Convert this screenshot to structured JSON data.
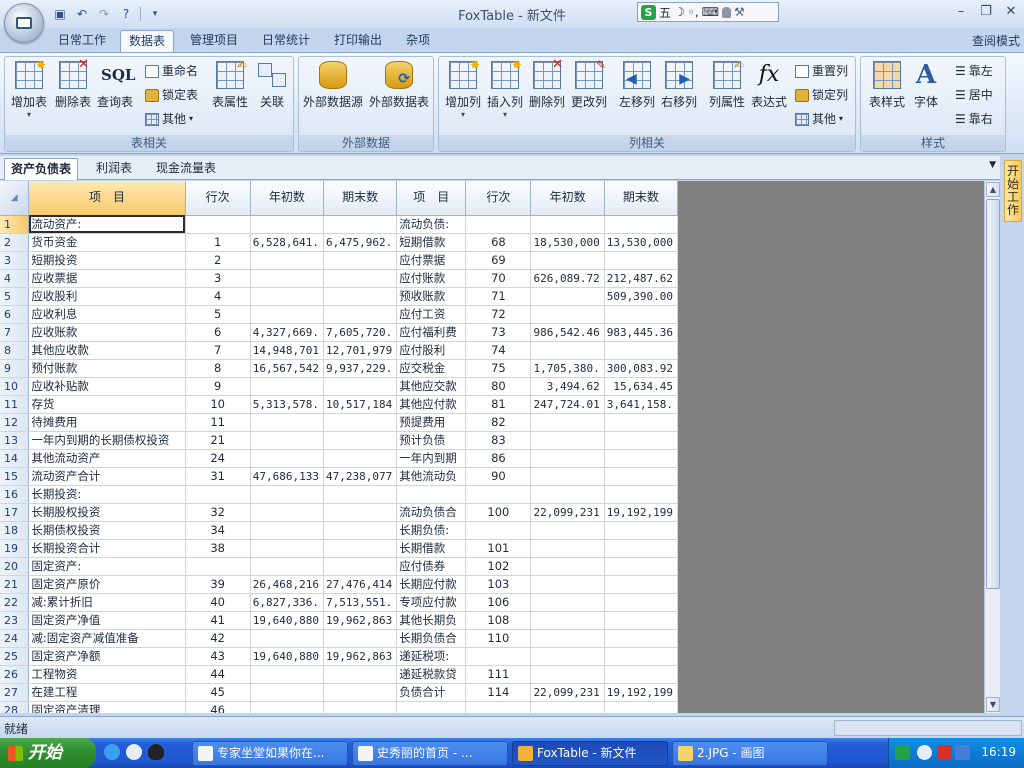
{
  "titlebar": {
    "title": "FoxTable - 新文件",
    "ime": {
      "s_logo": "S",
      "mode": "五",
      "moon": "☽",
      "punct": "◦,",
      "keyboard": "⌨",
      "user": "👤",
      "tool": "🔧"
    },
    "minimize": "–",
    "restore": "❐",
    "close": "✕"
  },
  "ribbon_tabs": [
    "日常工作",
    "数据表",
    "管理项目",
    "日常统计",
    "打印输出",
    "杂项"
  ],
  "active_tab": "数据表",
  "view_mode": "查阅模式",
  "groups": {
    "table": {
      "label": "表相关",
      "add_table": "增加表",
      "delete_table": "删除表",
      "query_table": "查询表",
      "rename": "重命名",
      "lock_table": "锁定表",
      "other": "其他",
      "table_props": "表属性",
      "relation": "关联"
    },
    "external": {
      "label": "外部数据",
      "source": "外部数据源",
      "table": "外部数据表"
    },
    "columns": {
      "label": "列相关",
      "add_col": "增加列",
      "insert_col": "插入列",
      "delete_col": "删除列",
      "rename_col": "更改列",
      "move_left": "左移列",
      "move_right": "右移列",
      "col_props": "列属性",
      "expression": "表达式",
      "reset_col": "重置列",
      "lock_col": "锁定列",
      "other": "其他"
    },
    "style": {
      "label": "样式",
      "table_style": "表样式",
      "font": "字体",
      "align_left": "靠左",
      "align_center": "居中",
      "align_right": "靠右"
    }
  },
  "sheet_tabs": [
    "资产负债表",
    "利润表",
    "现金流量表"
  ],
  "active_sheet": "资产负债表",
  "side_panel_label": "开始工作",
  "grid": {
    "headers": [
      "项　目",
      "行次",
      "年初数",
      "期末数",
      "项　目",
      "行次",
      "年初数",
      "期末数"
    ],
    "rows": [
      [
        "1",
        "流动资产:",
        "",
        "",
        "",
        "流动负债:",
        "",
        "",
        ""
      ],
      [
        "2",
        "货币资金",
        "1",
        "6,528,641.",
        "6,475,962.",
        "短期借款",
        "68",
        "18,530,000",
        "13,530,000"
      ],
      [
        "3",
        "短期投资",
        "2",
        "",
        "",
        "应付票据",
        "69",
        "",
        ""
      ],
      [
        "4",
        "应收票据",
        "3",
        "",
        "",
        "应付账款",
        "70",
        "626,089.72",
        "212,487.62"
      ],
      [
        "5",
        "应收股利",
        "4",
        "",
        "",
        "预收账款",
        "71",
        "",
        "509,390.00"
      ],
      [
        "6",
        "应收利息",
        "5",
        "",
        "",
        "应付工资",
        "72",
        "",
        ""
      ],
      [
        "7",
        "应收账款",
        "6",
        "4,327,669.",
        "7,605,720.",
        "应付福利费",
        "73",
        "986,542.46",
        "983,445.36"
      ],
      [
        "8",
        "其他应收款",
        "7",
        "14,948,701",
        "12,701,979",
        "应付股利",
        "74",
        "",
        ""
      ],
      [
        "9",
        "预付账款",
        "8",
        "16,567,542",
        "9,937,229.",
        "应交税金",
        "75",
        "1,705,380.",
        "300,083.92"
      ],
      [
        "10",
        "应收补贴款",
        "9",
        "",
        "",
        "其他应交款",
        "80",
        "3,494.62",
        "15,634.45"
      ],
      [
        "11",
        "存货",
        "10",
        "5,313,578.",
        "10,517,184",
        "其他应付款",
        "81",
        "247,724.01",
        "3,641,158."
      ],
      [
        "12",
        "待摊费用",
        "11",
        "",
        "",
        "预提费用",
        "82",
        "",
        ""
      ],
      [
        "13",
        "一年内到期的长期债权投资",
        "21",
        "",
        "",
        "预计负债",
        "83",
        "",
        ""
      ],
      [
        "14",
        "其他流动资产",
        "24",
        "",
        "",
        "一年内到期",
        "86",
        "",
        ""
      ],
      [
        "15",
        "流动资产合计",
        "31",
        "47,686,133",
        "47,238,077",
        "其他流动负",
        "90",
        "",
        ""
      ],
      [
        "16",
        "长期投资:",
        "",
        "",
        "",
        "",
        "",
        "",
        ""
      ],
      [
        "17",
        "长期股权投资",
        "32",
        "",
        "",
        "流动负债合",
        "100",
        "22,099,231",
        "19,192,199"
      ],
      [
        "18",
        "长期债权投资",
        "34",
        "",
        "",
        "长期负债:",
        "",
        "",
        ""
      ],
      [
        "19",
        "长期投资合计",
        "38",
        "",
        "",
        "长期借款",
        "101",
        "",
        ""
      ],
      [
        "20",
        "固定资产:",
        "",
        "",
        "",
        "应付债券",
        "102",
        "",
        ""
      ],
      [
        "21",
        "固定资产原价",
        "39",
        "26,468,216",
        "27,476,414",
        "长期应付款",
        "103",
        "",
        ""
      ],
      [
        "22",
        "减:累计折旧",
        "40",
        "6,827,336.",
        "7,513,551.",
        "专项应付款",
        "106",
        "",
        ""
      ],
      [
        "23",
        "固定资产净值",
        "41",
        "19,640,880",
        "19,962,863",
        "其他长期负",
        "108",
        "",
        ""
      ],
      [
        "24",
        "减:固定资产减值准备",
        "42",
        "",
        "",
        "长期负债合",
        "110",
        "",
        ""
      ],
      [
        "25",
        "固定资产净额",
        "43",
        "19,640,880",
        "19,962,863",
        "递延税项:",
        "",
        "",
        ""
      ],
      [
        "26",
        "工程物资",
        "44",
        "",
        "",
        "递延税款贷",
        "111",
        "",
        ""
      ],
      [
        "27",
        "在建工程",
        "45",
        "",
        "",
        "负债合计",
        "114",
        "22,099,231",
        "19,192,199"
      ],
      [
        "28",
        "固定资产清理",
        "46",
        "",
        "",
        "",
        "",
        "",
        ""
      ]
    ]
  },
  "status": "就绪",
  "taskbar": {
    "start": "开始",
    "tasks": [
      "专家坐堂如果你在...",
      "史秀丽的首页 - ...",
      "FoxTable - 新文件",
      "2.JPG - 画图"
    ],
    "active_task": "FoxTable - 新文件",
    "clock": "16:19"
  },
  "colors": {
    "ribbon_bg": "#dbe7f6",
    "selected_header": "#f7c96a",
    "taskbar": "#245ed6",
    "start_button": "#329032",
    "gray_area": "#808080"
  }
}
